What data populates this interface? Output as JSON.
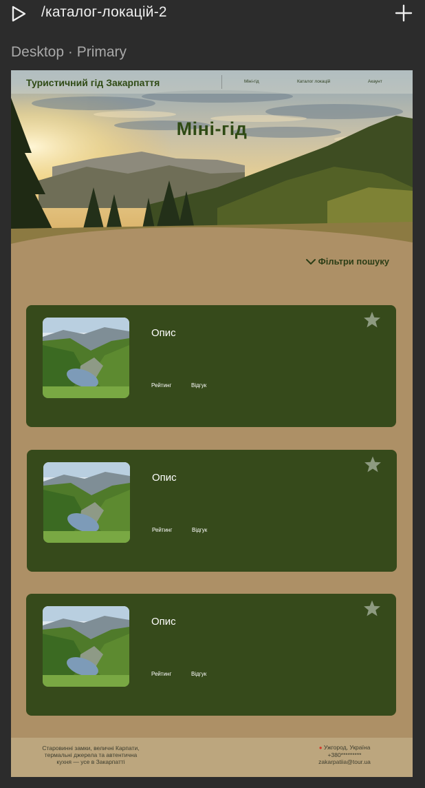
{
  "toolbar": {
    "route": "/каталог-локацій-2",
    "play_icon": "play-icon",
    "add_icon": "plus-icon"
  },
  "frame": {
    "label": "Desktop · Primary"
  },
  "site": {
    "brand": "Туристичний гід Закарпаття",
    "nav": [
      "Міні-гід",
      "Каталог локацій",
      "Акаунт"
    ],
    "hero_title": "Міні-гід",
    "filters_label": "Фільтри пошуку"
  },
  "cards": [
    {
      "title": "Опис",
      "rating_label": "Рейтинг",
      "review_label": "Відгук",
      "star_icon": "star-icon"
    },
    {
      "title": "Опис",
      "rating_label": "Рейтинг",
      "review_label": "Відгук",
      "star_icon": "star-icon"
    },
    {
      "title": "Опис",
      "rating_label": "Рейтинг",
      "review_label": "Відгук",
      "star_icon": "star-icon"
    }
  ],
  "footer": {
    "tagline_lines": [
      "Старовинні замки, величні Карпати,",
      "термальні джерела та автентична",
      "кухня — усе в Закарпатті"
    ],
    "city": "Ужгород, Україна",
    "phone": "+380*********",
    "email": "zakarpatiia@tour.ua"
  },
  "colors": {
    "page_bg": "#2c2c2c",
    "artboard_bg": "#ad9066",
    "card_bg": "#364a1b",
    "brand_green": "#2f4a14",
    "footer_bg": "#bca67e"
  }
}
